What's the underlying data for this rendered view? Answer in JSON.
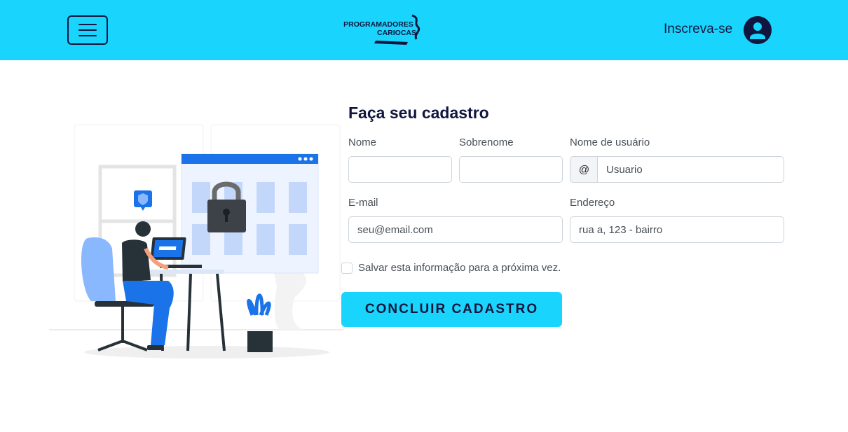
{
  "header": {
    "menu_label": "",
    "logo_text_line1": "PROGRAMADORES",
    "logo_text_line2": "CARIOCAS",
    "signup_label": "Inscreva-se",
    "bg_color": "#19d4fc",
    "accent_color": "#10163f"
  },
  "form": {
    "title": "Faça seu cadastro",
    "first_name": {
      "label": "Nome",
      "value": "",
      "placeholder": ""
    },
    "last_name": {
      "label": "Sobrenome",
      "value": "",
      "placeholder": ""
    },
    "username": {
      "label": "Nome de usuário",
      "prefix": "@",
      "placeholder": "Usuario"
    },
    "email": {
      "label": "E-mail",
      "placeholder": "seu@email.com"
    },
    "address": {
      "label": "Endereço",
      "placeholder": "rua a, 123 - bairro"
    },
    "save_info_label": "Salvar esta informação para a próxima vez.",
    "save_info_checked": false,
    "submit_label": "CONCLUIR CADASTRO"
  },
  "icons": {
    "menu": "hamburger-icon",
    "avatar": "user-icon",
    "illustration": "security-login-illustration"
  }
}
